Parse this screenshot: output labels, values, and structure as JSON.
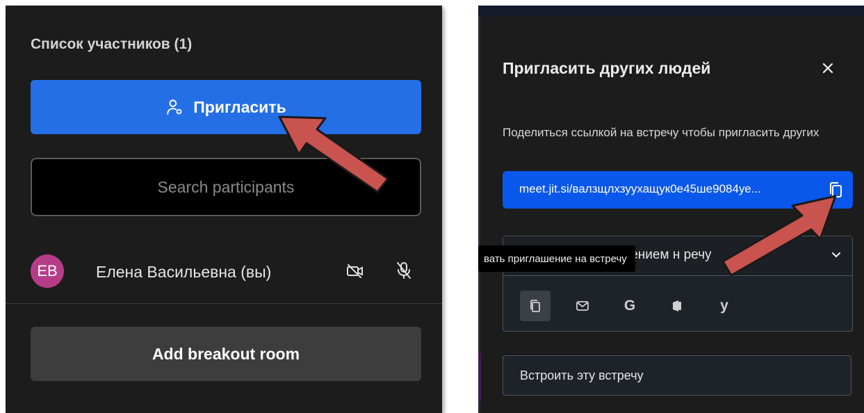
{
  "participants_panel": {
    "title": "Список участников (1)",
    "invite_label": "Пригласить",
    "search_placeholder": "Search participants",
    "participants": [
      {
        "initials": "EB",
        "name": "Елена Васильевна (вы)",
        "avatar_color": "#b63c88"
      }
    ],
    "breakout_label": "Add breakout room",
    "accent_color": "#246fe5"
  },
  "invite_dialog": {
    "title": "Пригласить других людей",
    "share_text": "Поделиться ссылкой на встречу чтобы пригласить других",
    "meeting_link": "meet.jit.si/валзщлхзуухащук0е45ше9084уе...",
    "invite_header_visible": "шением н   речу",
    "tooltip": "вать приглашение на встречу",
    "share_options": [
      {
        "icon": "copy-icon",
        "glyph": ""
      },
      {
        "icon": "mail-icon",
        "glyph": ""
      },
      {
        "icon": "google-icon",
        "glyph": "G"
      },
      {
        "icon": "outlook-icon",
        "glyph": ""
      },
      {
        "icon": "yahoo-icon",
        "glyph": "y"
      }
    ],
    "embed_label": "Встроить эту встречу",
    "link_color": "#0a57eb"
  },
  "annotation": {
    "arrow_color": "#c9534f"
  }
}
